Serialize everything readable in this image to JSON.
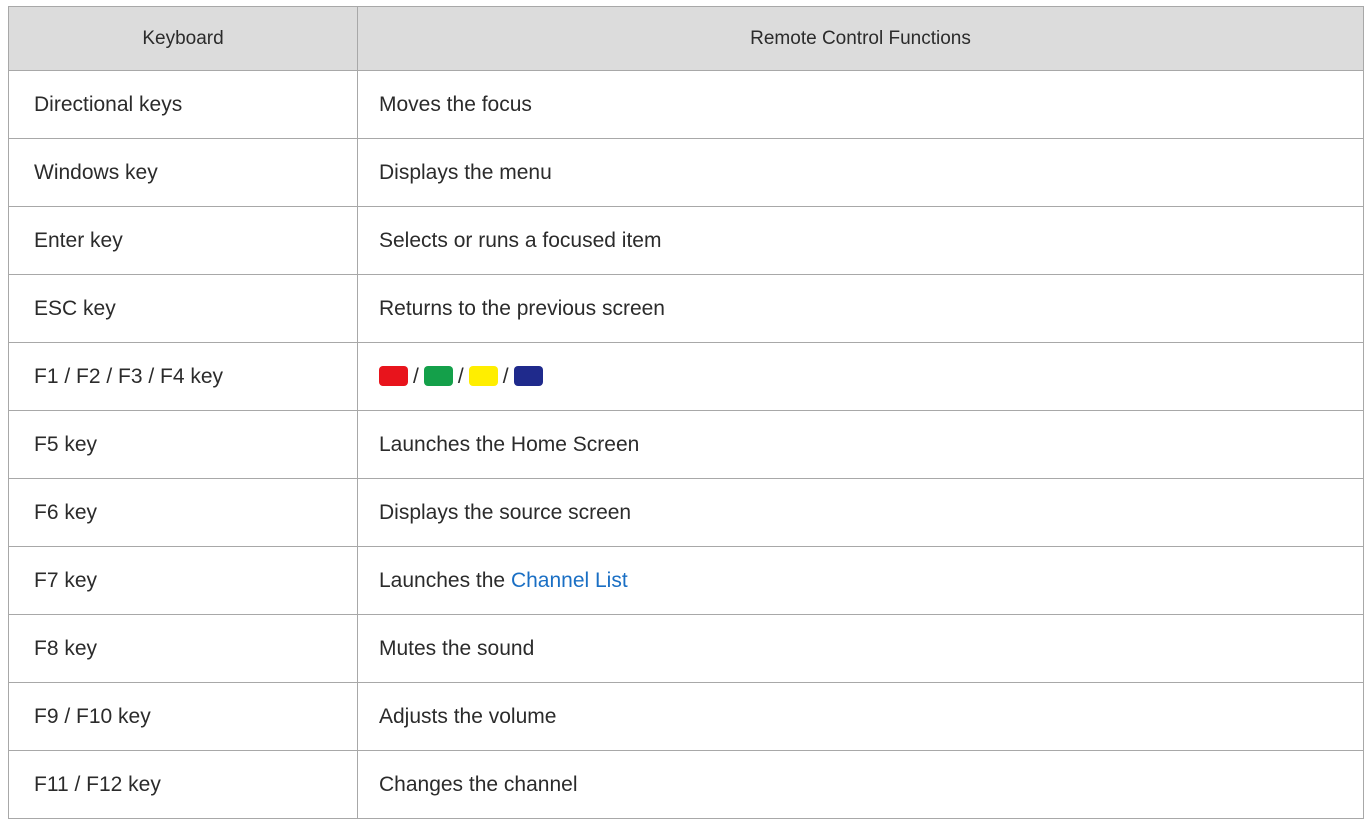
{
  "table": {
    "headers": {
      "keyboard": "Keyboard",
      "remote": "Remote Control Functions"
    },
    "rows": [
      {
        "key": "Directional keys",
        "function": "Moves the focus"
      },
      {
        "key": "Windows key",
        "function": "Displays the menu"
      },
      {
        "key": "Enter key",
        "function": "Selects or runs a focused item"
      },
      {
        "key": "ESC key",
        "function": "Returns to the previous screen"
      },
      {
        "key": "F1 / F2 / F3 / F4 key",
        "function_swatches": {
          "colors": [
            "#e8141c",
            "#14a04a",
            "#ffee00",
            "#1f2a8c"
          ],
          "separator": "/"
        }
      },
      {
        "key": "F5 key",
        "function": "Launches the Home Screen"
      },
      {
        "key": "F6 key",
        "function": "Displays the source screen"
      },
      {
        "key": "F7 key",
        "function_prefix": "Launches the ",
        "function_link": "Channel List"
      },
      {
        "key": "F8 key",
        "function": "Mutes the sound"
      },
      {
        "key": "F9 / F10 key",
        "function": "Adjusts the volume"
      },
      {
        "key": "F11 / F12 key",
        "function": "Changes the channel"
      }
    ]
  },
  "colors": {
    "header_bg": "#dcdcdc",
    "border": "#a8a8a8",
    "link": "#1a6fc4"
  }
}
